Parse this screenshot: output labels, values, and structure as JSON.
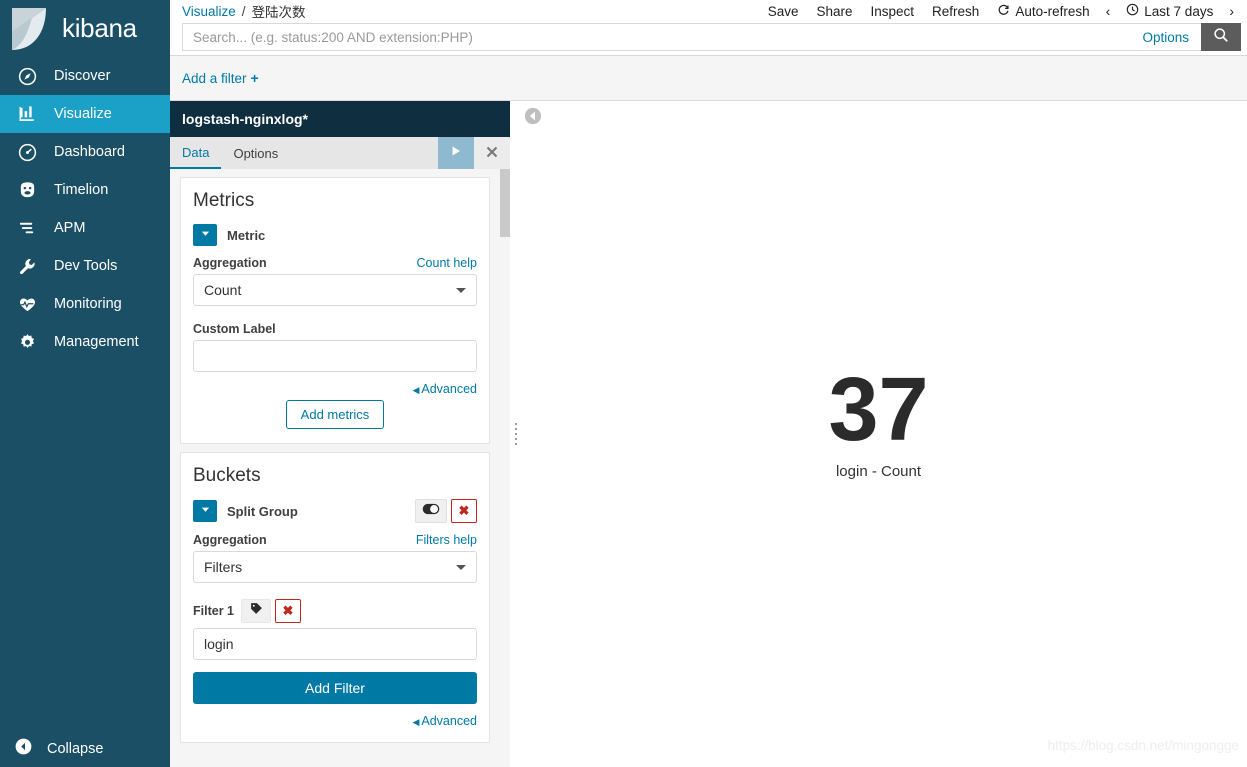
{
  "sidebar": {
    "brand": "kibana",
    "items": [
      {
        "label": "Discover",
        "icon": "compass-icon"
      },
      {
        "label": "Visualize",
        "icon": "bar-chart-icon"
      },
      {
        "label": "Dashboard",
        "icon": "dashboard-icon"
      },
      {
        "label": "Timelion",
        "icon": "timelion-icon"
      },
      {
        "label": "APM",
        "icon": "apm-icon"
      },
      {
        "label": "Dev Tools",
        "icon": "wrench-icon"
      },
      {
        "label": "Monitoring",
        "icon": "heartbeat-icon"
      },
      {
        "label": "Management",
        "icon": "gear-icon"
      }
    ],
    "active_index": 1,
    "collapse": {
      "label": "Collapse",
      "icon": "collapse-left-icon"
    }
  },
  "topbar": {
    "breadcrumb": {
      "root": "Visualize",
      "separator": "/",
      "current": "登陆次数"
    },
    "actions": [
      {
        "label": "Save",
        "icon": null
      },
      {
        "label": "Share",
        "icon": null
      },
      {
        "label": "Inspect",
        "icon": null
      },
      {
        "label": "Refresh",
        "icon": null
      },
      {
        "label": "Auto-refresh",
        "icon": "refresh-icon"
      }
    ],
    "time_prev": "‹",
    "time_next": "›",
    "time_label": "Last 7 days",
    "time_icon": "clock-icon"
  },
  "query": {
    "value": "",
    "placeholder": "Search... (e.g. status:200 AND extension:PHP)",
    "options_label": "Options",
    "search_icon": "search-icon"
  },
  "filterbar": {
    "add_filter_label": "Add a filter",
    "plus": "+"
  },
  "editor": {
    "index_pattern": "logstash-nginxlog*",
    "tabs": [
      {
        "label": "Data",
        "active": true
      },
      {
        "label": "Options",
        "active": false
      }
    ],
    "apply_icon": "play-icon",
    "close_icon": "close-icon",
    "metrics": {
      "title": "Metrics",
      "agg_title": "Metric",
      "aggregation_label": "Aggregation",
      "help_link": "Count help",
      "aggregation_value": "Count",
      "custom_label_label": "Custom Label",
      "custom_label_value": "",
      "advanced_label": "Advanced",
      "add_metrics_label": "Add metrics"
    },
    "buckets": {
      "title": "Buckets",
      "agg_title": "Split Group",
      "aggregation_label": "Aggregation",
      "help_link": "Filters help",
      "aggregation_value": "Filters",
      "filter_label": "Filter 1",
      "filter_value": "login",
      "add_filter_button": "Add Filter",
      "advanced_label": "Advanced",
      "toggle_icon": "toggle-icon",
      "remove_icon": "remove-icon",
      "tag_icon": "tag-icon"
    }
  },
  "visualization": {
    "collapse_icon": "collapse-left-circle-icon",
    "metric_value": "37",
    "metric_label": "login - Count"
  },
  "watermark": "https://blog.csdn.net/mingongge",
  "colors": {
    "sidebar_bg": "#1a4f66",
    "sidebar_active": "#1ba0c8",
    "accent": "#0079a5",
    "panel_header": "#0f2f41",
    "danger": "#bd271e",
    "metric_text": "#2b2b2b"
  }
}
